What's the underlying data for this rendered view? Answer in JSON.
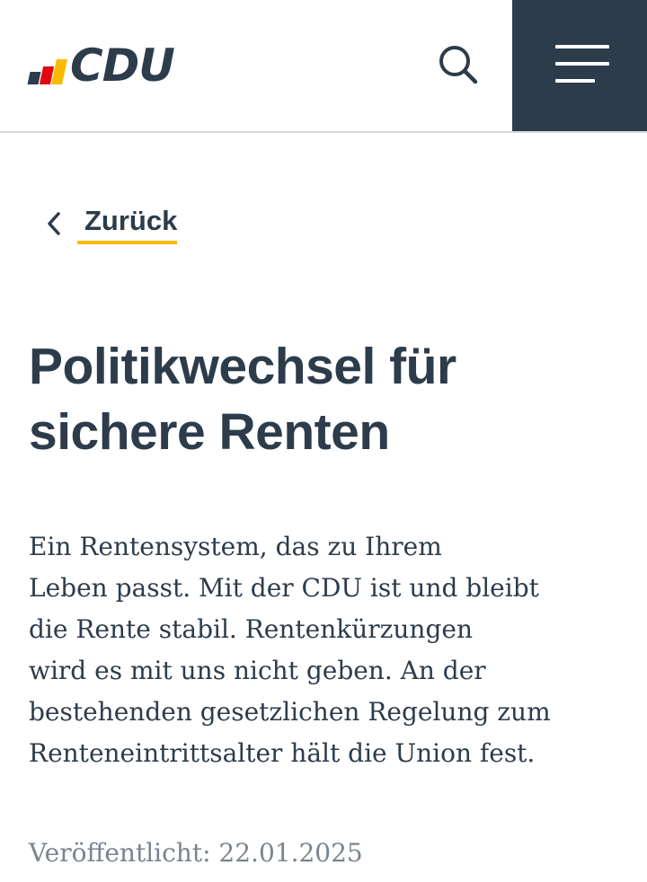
{
  "header": {
    "logo_text": "CDU",
    "search_icon": "search-icon",
    "menu_icon": "hamburger-menu-icon"
  },
  "colors": {
    "primary": "#2d3c4b",
    "accent": "#fbb900",
    "red": "#e30613",
    "muted": "#7b848f"
  },
  "back": {
    "label": "Zurück",
    "icon": "chevron-left-icon"
  },
  "article": {
    "title_line_1": "Politikwechsel für",
    "title_line_2": "sichere Renten",
    "body_lines": [
      "Ein Rentensystem, das zu Ihrem",
      "Leben passt. Mit der CDU ist und bleibt",
      "die Rente stabil. Rentenkürzungen",
      "wird es mit uns nicht geben. An der",
      "bestehenden gesetzlichen Regelung zum",
      "Renteneintrittsalter hält die Union fest."
    ],
    "published": "Veröffentlicht: 22.01.2025"
  }
}
